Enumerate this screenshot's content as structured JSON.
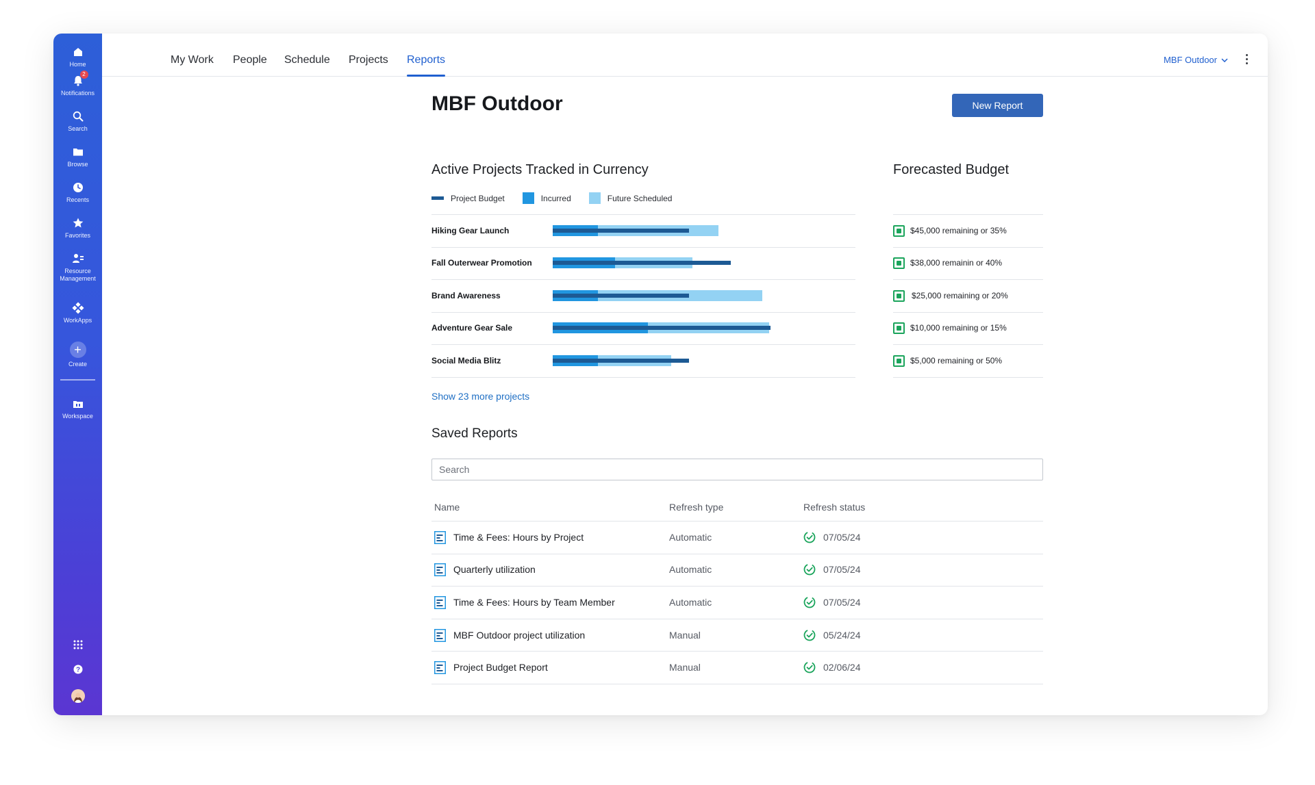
{
  "sidebar": {
    "items": [
      {
        "label": "Home",
        "icon": "home-icon"
      },
      {
        "label": "Notifications",
        "icon": "bell-icon",
        "badge": "2"
      },
      {
        "label": "Search",
        "icon": "search-icon"
      },
      {
        "label": "Browse",
        "icon": "folder-icon"
      },
      {
        "label": "Recents",
        "icon": "clock-icon"
      },
      {
        "label": "Favorites",
        "icon": "star-icon"
      },
      {
        "label": "Resource Management",
        "icon": "people-icon"
      },
      {
        "label": "WorkApps",
        "icon": "workapps-icon"
      },
      {
        "label": "Create",
        "icon": "plus-icon"
      },
      {
        "label": "Workspace",
        "icon": "workspace-icon"
      }
    ],
    "bottom": [
      {
        "icon": "apps-grid-icon"
      },
      {
        "icon": "help-icon"
      },
      {
        "icon": "avatar"
      }
    ]
  },
  "topnav": {
    "tabs": [
      {
        "label": "My Work"
      },
      {
        "label": "People"
      },
      {
        "label": "Schedule"
      },
      {
        "label": "Projects"
      },
      {
        "label": "Reports",
        "active": true
      }
    ],
    "workspace": "MBF Outdoor"
  },
  "main": {
    "title": "MBF Outdoor",
    "new_report": "New Report",
    "active_projects": {
      "title": "Active Projects Tracked in Currency",
      "legend": [
        "Project Budget",
        "Incurred",
        "Future Scheduled"
      ],
      "show_more": "Show 23 more projects"
    },
    "forecast": {
      "title": "Forecasted Budget",
      "items": [
        "$45,000 remaining or 35%",
        "$38,000 remainin or 40%",
        "$25,000 remaining or 20%",
        "$10,000 remaining or 15%",
        "$5,000 remaining or 50%"
      ]
    },
    "saved_reports": {
      "title": "Saved Reports",
      "search_placeholder": "Search",
      "columns": [
        "Name",
        "Refresh type",
        "Refresh status"
      ],
      "rows": [
        {
          "name": "Time & Fees: Hours by Project",
          "type": "Automatic",
          "status": "07/05/24"
        },
        {
          "name": "Quarterly utilization",
          "type": "Automatic",
          "status": "07/05/24"
        },
        {
          "name": "Time & Fees: Hours by Team Member",
          "type": "Automatic",
          "status": "07/05/24"
        },
        {
          "name": "MBF Outdoor project utilization",
          "type": "Manual",
          "status": "05/24/24"
        },
        {
          "name": "Project Budget Report",
          "type": "Manual",
          "status": "02/06/24"
        }
      ]
    }
  },
  "chart_data": {
    "type": "bar",
    "categories": [
      "Hiking Gear Launch",
      "Fall Outerwear Promotion",
      "Brand Awareness",
      "Adventure Gear Sale",
      "Social Media Blitz"
    ],
    "series": [
      {
        "name": "Project Budget",
        "values": [
          50,
          65.5,
          50,
          80,
          50
        ]
      },
      {
        "name": "Incurred",
        "values": [
          16.5,
          23,
          16.5,
          35,
          16.5
        ]
      },
      {
        "name": "Future Scheduled",
        "values": [
          44.5,
          28.5,
          60.5,
          44.5,
          27
        ]
      }
    ],
    "xlim": [
      0,
      100
    ],
    "colors": {
      "Project Budget": "#1d5a94",
      "Incurred": "#2196e0",
      "Future Scheduled": "#93d2f3"
    }
  },
  "colors": {
    "accent": "#1f5fcf",
    "button": "#3366b8",
    "success": "#1aa45b"
  }
}
